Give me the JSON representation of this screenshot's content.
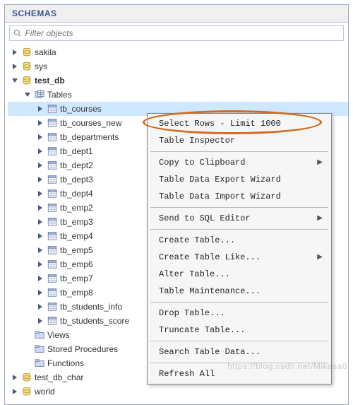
{
  "panel": {
    "title": "SCHEMAS"
  },
  "search": {
    "placeholder": "Filter objects"
  },
  "tree": {
    "schemas": [
      {
        "name": "sakila",
        "expanded": false
      },
      {
        "name": "sys",
        "expanded": false
      },
      {
        "name": "test_db",
        "expanded": true,
        "bold": true,
        "children": [
          {
            "name": "Tables",
            "kind": "folder-tables",
            "expanded": true,
            "tables": [
              "tb_courses",
              "tb_courses_new",
              "tb_departments",
              "tb_dept1",
              "tb_dept2",
              "tb_dept3",
              "tb_dept4",
              "tb_emp2",
              "tb_emp3",
              "tb_emp4",
              "tb_emp5",
              "tb_emp6",
              "tb_emp7",
              "tb_emp8",
              "tb_students_info",
              "tb_students_score"
            ],
            "selected_table_index": 0
          },
          {
            "name": "Views",
            "kind": "folder-views",
            "expanded": false
          },
          {
            "name": "Stored Procedures",
            "kind": "folder-procs",
            "expanded": false
          },
          {
            "name": "Functions",
            "kind": "folder-funcs",
            "expanded": false
          }
        ]
      },
      {
        "name": "test_db_char",
        "expanded": false
      },
      {
        "name": "world",
        "expanded": false
      }
    ]
  },
  "context_menu": {
    "groups": [
      [
        {
          "label": "Select Rows - Limit 1000"
        },
        {
          "label": "Table Inspector"
        }
      ],
      [
        {
          "label": "Copy to Clipboard",
          "submenu": true
        },
        {
          "label": "Table Data Export Wizard"
        },
        {
          "label": "Table Data Import Wizard"
        }
      ],
      [
        {
          "label": "Send to SQL Editor",
          "submenu": true
        }
      ],
      [
        {
          "label": "Create Table..."
        },
        {
          "label": "Create Table Like...",
          "submenu": true
        },
        {
          "label": "Alter Table..."
        },
        {
          "label": "Table Maintenance..."
        }
      ],
      [
        {
          "label": "Drop Table..."
        },
        {
          "label": "Truncate Table..."
        }
      ],
      [
        {
          "label": "Search Table Data..."
        }
      ],
      [
        {
          "label": "Refresh All"
        }
      ]
    ]
  },
  "watermark": "https://blog.csdn.net/Mikasa8"
}
